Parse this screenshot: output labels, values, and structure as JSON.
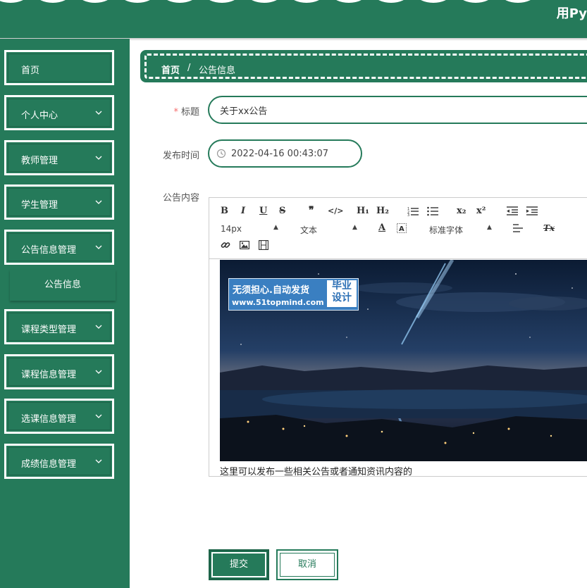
{
  "header": {
    "title": "用Py"
  },
  "sidebar": {
    "items": [
      {
        "label": "首页",
        "has_children": false
      },
      {
        "label": "个人中心",
        "has_children": true
      },
      {
        "label": "教师管理",
        "has_children": true
      },
      {
        "label": "学生管理",
        "has_children": true
      },
      {
        "label": "公告信息管理",
        "has_children": true,
        "expanded": true
      },
      {
        "label": "课程类型管理",
        "has_children": true
      },
      {
        "label": "课程信息管理",
        "has_children": true
      },
      {
        "label": "选课信息管理",
        "has_children": true
      },
      {
        "label": "成绩信息管理",
        "has_children": true
      }
    ],
    "sub_item": {
      "label": "公告信息"
    }
  },
  "breadcrumb": {
    "home": "首页",
    "separator": "/",
    "current": "公告信息"
  },
  "form": {
    "title": {
      "label": "标题",
      "required_mark": "*",
      "value": "关于xx公告"
    },
    "publish_time": {
      "label": "发布时间",
      "value": "2022-04-16 00:43:07"
    },
    "content": {
      "label": "公告内容"
    }
  },
  "editor": {
    "toolbar": {
      "bold": "B",
      "italic": "I",
      "underline": "U",
      "strike": "S",
      "quote": "❞",
      "code": "</>",
      "h1": "H₁",
      "h2": "H₂",
      "sub": "x₂",
      "sup": "x²",
      "font_size": "14px",
      "paragraph": "文本",
      "font_family": "标准字体",
      "text_color": "A",
      "clear_format": "Tx"
    },
    "image": {
      "watermark_line1": "无须担心.自动发货",
      "watermark_line2": "www.51topmind.com",
      "watermark_badge_1": "毕业",
      "watermark_badge_2": "设计"
    },
    "text": "这里可以发布一些相关公告或者通知资讯内容的"
  },
  "buttons": {
    "submit": "提交",
    "cancel": "取消"
  },
  "colors": {
    "primary": "#257a5a",
    "primary_dark": "#1d6449",
    "required": "#f56c6c"
  }
}
